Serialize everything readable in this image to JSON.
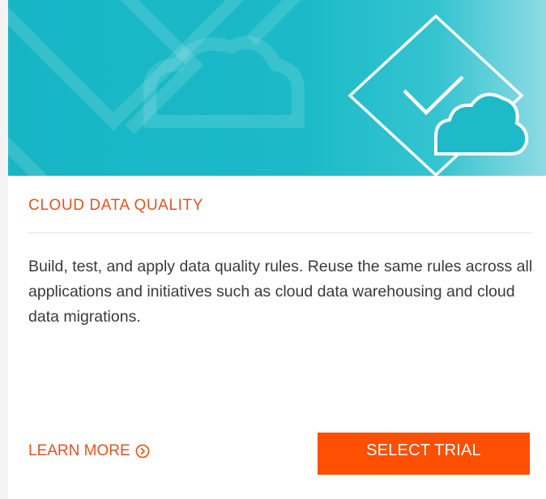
{
  "card": {
    "hero_image": "cloud-checkmark-illustration",
    "title": "CLOUD DATA QUALITY",
    "description": "Build, test, and apply data quality rules. Reuse the same rules across all applications and initiatives such as cloud data warehousing and cloud data migrations.",
    "learn_more_label": "LEARN MORE",
    "learn_more_icon": "chevron-right-circle-icon",
    "select_trial_label": "SELECT TRIAL"
  },
  "colors": {
    "accent": "#e1541f",
    "button": "#ff4f00",
    "hero": "#1cbac8",
    "text": "#3a3a3a"
  }
}
